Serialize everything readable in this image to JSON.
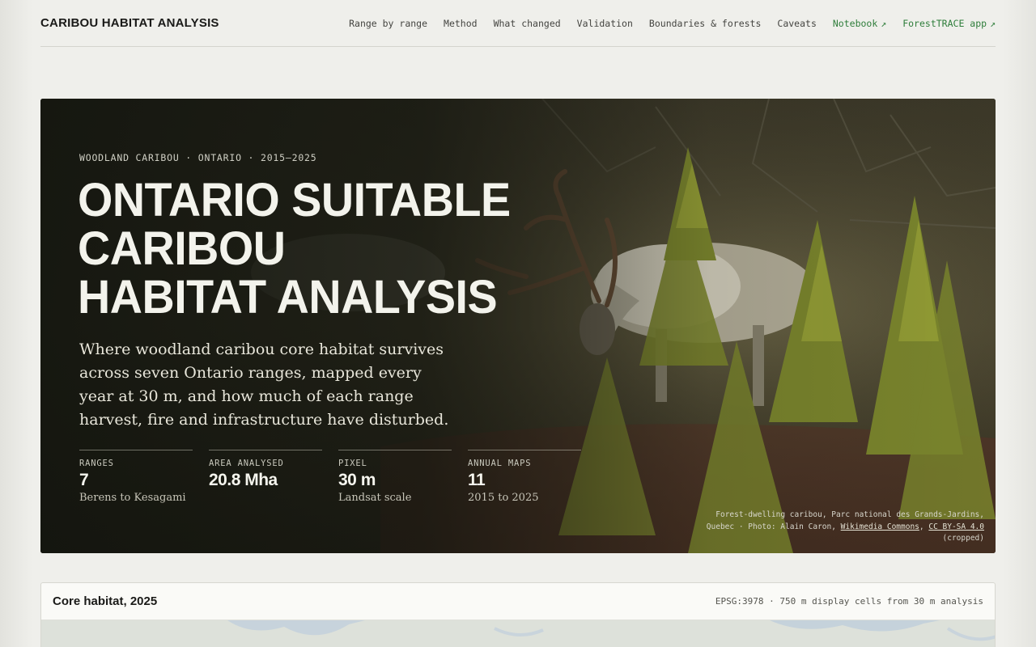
{
  "site": {
    "brand": "CARIBOU HABITAT ANALYSIS"
  },
  "nav": {
    "items": [
      {
        "label": "Range by range",
        "external": false
      },
      {
        "label": "Method",
        "external": false
      },
      {
        "label": "What changed",
        "external": false
      },
      {
        "label": "Validation",
        "external": false
      },
      {
        "label": "Boundaries & forests",
        "external": false
      },
      {
        "label": "Caveats",
        "external": false
      },
      {
        "label": "Notebook",
        "external": true,
        "arrow": "↗"
      },
      {
        "label": "ForestTRACE app",
        "external": true,
        "arrow": "↗"
      }
    ],
    "external_color": "#2e7d3a"
  },
  "hero": {
    "eyebrow": "WOODLAND CARIBOU · ONTARIO · 2015–2025",
    "title_lines": [
      "ONTARIO SUITABLE",
      "CARIBOU",
      "HABITAT ANALYSIS"
    ],
    "lede": "Where woodland caribou core habitat survives across seven Ontario ranges, mapped every year at 30 m, and how much of each range harvest, fire and infrastructure have disturbed.",
    "stats": [
      {
        "label": "RANGES",
        "value": "7",
        "sub": "Berens to Kesagami"
      },
      {
        "label": "AREA ANALYSED",
        "value": "20.8 Mha",
        "sub": ""
      },
      {
        "label": "PIXEL",
        "value": "30 m",
        "sub": "Landsat scale"
      },
      {
        "label": "ANNUAL MAPS",
        "value": "11",
        "sub": "2015 to 2025"
      }
    ],
    "credit": {
      "line1": "Forest-dwelling caribou, Parc national des Grands-Jardins,",
      "line2_prefix": "Quebec · Photo: Alain Caron, ",
      "link1": "Wikimedia Commons",
      "sep": ", ",
      "link2": "CC BY-SA 4.0",
      "line3": "(cropped)"
    }
  },
  "card": {
    "title": "Core habitat, 2025",
    "meta": "EPSG:3978 · 750 m display cells from 30 m analysis"
  },
  "colors": {
    "background": "#efefeb",
    "accent_green": "#2e7d3a"
  }
}
